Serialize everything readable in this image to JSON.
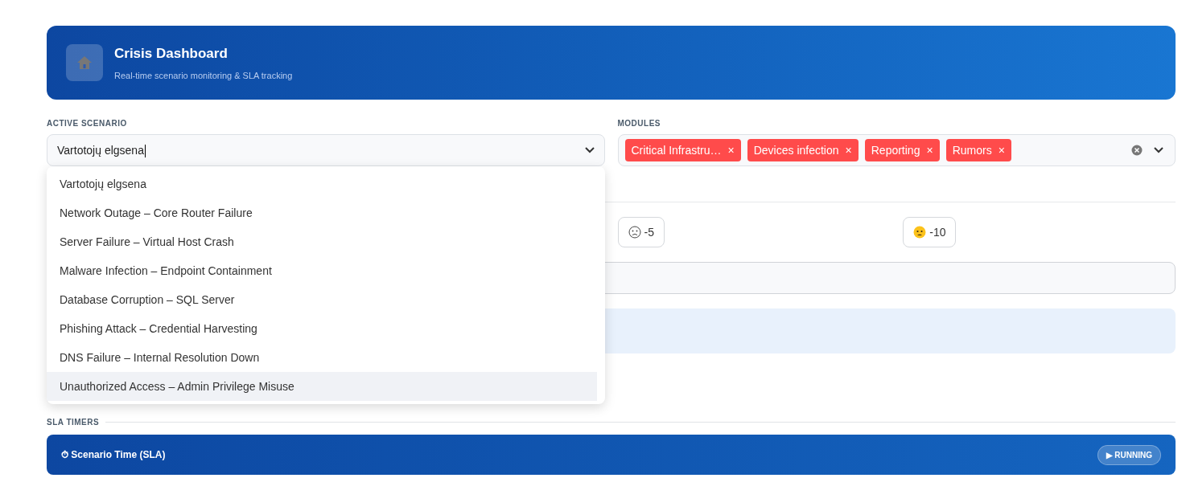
{
  "header": {
    "title": "Crisis Dashboard",
    "subtitle": "Real-time scenario monitoring & SLA tracking"
  },
  "scenario": {
    "label": "ACTIVE SCENARIO",
    "value": "Vartotojų elgsena",
    "open": true,
    "options": [
      {
        "label": "Vartotojų elgsena",
        "highlighted": false
      },
      {
        "label": "Network Outage – Core Router Failure",
        "highlighted": false
      },
      {
        "label": "Server Failure – Virtual Host Crash",
        "highlighted": false
      },
      {
        "label": "Malware Infection – Endpoint Containment",
        "highlighted": false
      },
      {
        "label": "Database Corruption – SQL Server",
        "highlighted": false
      },
      {
        "label": "Phishing Attack – Credential Harvesting",
        "highlighted": false
      },
      {
        "label": "DNS Failure – Internal Resolution Down",
        "highlighted": false
      },
      {
        "label": "Unauthorized Access – Admin Privilege Misuse",
        "highlighted": true
      }
    ]
  },
  "modules": {
    "label": "MODULES",
    "tags": [
      {
        "label": "Critical Infrastru…",
        "color": "#ff4b4b"
      },
      {
        "label": "Devices infection",
        "color": "#ff4b4b"
      },
      {
        "label": "Reporting",
        "color": "#ff4b4b"
      },
      {
        "label": "Rumors",
        "color": "#ff4b4b"
      }
    ],
    "remove_mark": "×"
  },
  "scores": [
    {
      "kind": "sad",
      "label": "-5"
    },
    {
      "kind": "worried",
      "label": "-10"
    }
  ],
  "sla": {
    "label": "SLA TIMERS",
    "timer_title": "⏱ Scenario Time (SLA)",
    "status": "▶ RUNNING"
  }
}
